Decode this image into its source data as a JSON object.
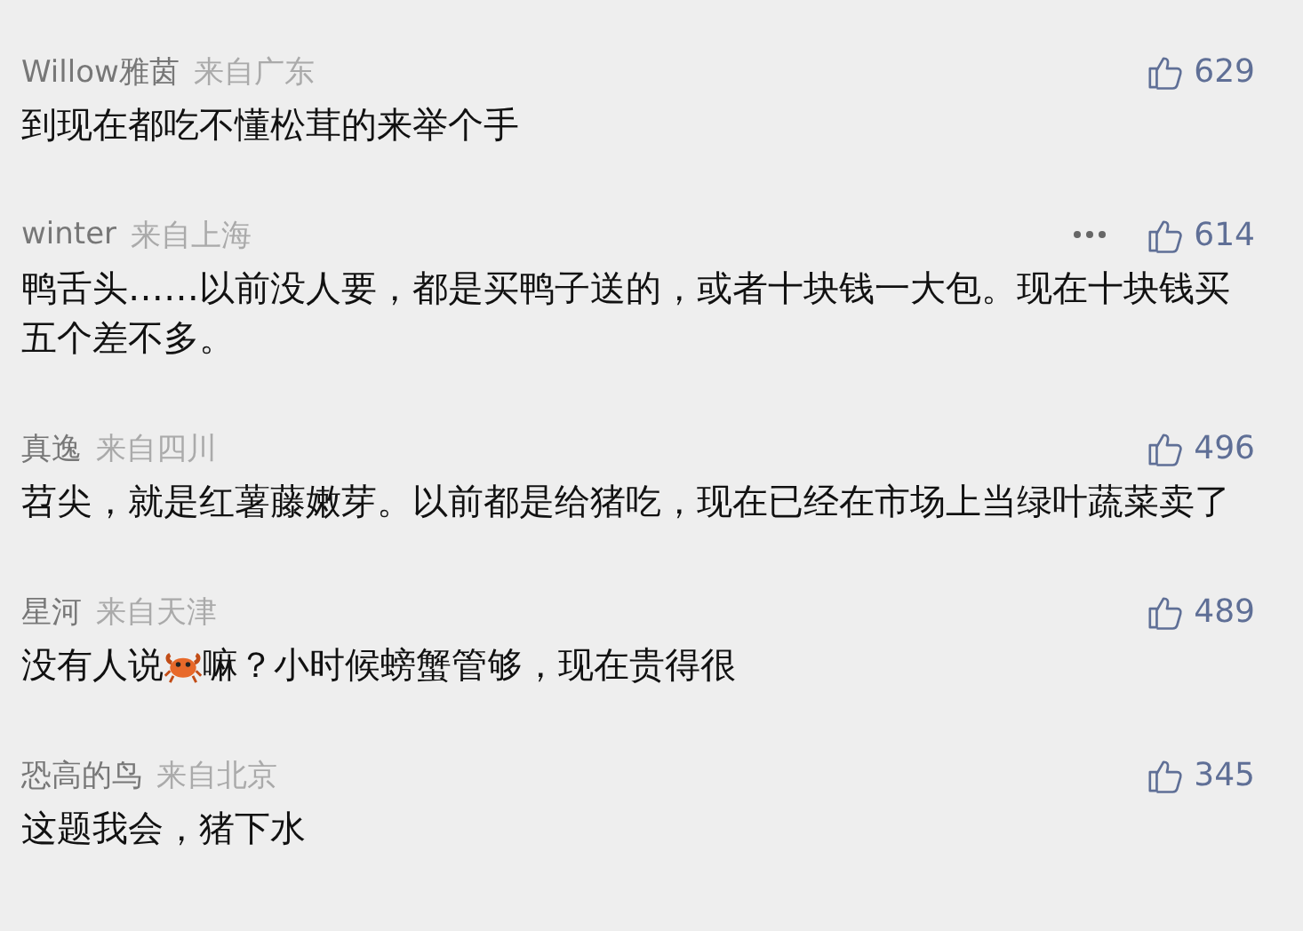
{
  "comments": [
    {
      "user": "Willow雅茵",
      "location": "来自广东",
      "more_menu": false,
      "likes": "629",
      "segments": [
        {
          "kind": "text",
          "text": "到现在都吃不懂松茸的来举个手"
        }
      ]
    },
    {
      "user": "winter",
      "location": "来自上海",
      "more_menu": true,
      "likes": "614",
      "segments": [
        {
          "kind": "text",
          "text": "鸭舌头……以前没人要，都是买鸭子送的，或者十块钱一大包。现在十块钱买五个差不多。"
        }
      ]
    },
    {
      "user": "真逸",
      "location": "来自四川",
      "more_menu": false,
      "likes": "496",
      "segments": [
        {
          "kind": "text",
          "text": "苕尖，就是红薯藤嫩芽。以前都是给猪吃，现在已经在市场上当绿叶蔬菜卖了"
        }
      ]
    },
    {
      "user": "星河",
      "location": "来自天津",
      "more_menu": false,
      "likes": "489",
      "segments": [
        {
          "kind": "text",
          "text": "没有人说"
        },
        {
          "kind": "crab"
        },
        {
          "kind": "text",
          "text": "嘛？小时候螃蟹管够，现在贵得很"
        }
      ]
    },
    {
      "user": "恐高的鸟",
      "location": "来自北京",
      "more_menu": false,
      "likes": "345",
      "segments": [
        {
          "kind": "text",
          "text": "这题我会，猪下水"
        }
      ]
    }
  ]
}
